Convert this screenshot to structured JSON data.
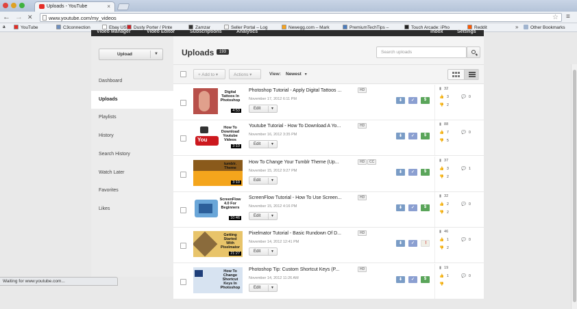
{
  "browser": {
    "tab_title": "Uploads - YouTube",
    "tab_close": "×",
    "url": "www.youtube.com/my_videos",
    "back": "←",
    "forward": "→",
    "reload": "✕",
    "star": "☆",
    "wrench": "≡",
    "bookmarks": [
      {
        "label": "YouTube",
        "color": "#e52d27"
      },
      {
        "label": "C3connection",
        "color": "#6e8fbf"
      },
      {
        "label": "Ebay US",
        "color": "#ffffff"
      },
      {
        "label": "Dusty Porter / Pinte",
        "color": "#cb2027"
      },
      {
        "label": "Zamzar",
        "color": "#333333"
      },
      {
        "label": "Seller Portal – Log",
        "color": "#f3f3f3"
      },
      {
        "label": "Newegg.com – Mark",
        "color": "#f7a21b"
      },
      {
        "label": "PremiumTechTips –",
        "color": "#4a7bbd"
      },
      {
        "label": "Touch Arcade: iPho",
        "color": "#222222"
      },
      {
        "label": "Reddit",
        "color": "#ff5700"
      }
    ],
    "bookmarks_more": "»",
    "other_bookmarks": "Other Bookmarks",
    "status_text": "Waiting for www.youtube.com..."
  },
  "topnav": [
    "Video Manager",
    "Video Editor",
    "Subscriptions",
    "Analytics",
    "Inbox",
    "Settings"
  ],
  "sidebar": {
    "upload_label": "Upload",
    "items": [
      {
        "label": "Dashboard",
        "active": false
      },
      {
        "label": "Uploads",
        "active": true
      },
      {
        "label": "Playlists",
        "active": false
      },
      {
        "label": "History",
        "active": false
      },
      {
        "label": "Search History",
        "active": false
      },
      {
        "label": "Watch Later",
        "active": false
      },
      {
        "label": "Favorites",
        "active": false
      },
      {
        "label": "Likes",
        "active": false
      }
    ]
  },
  "main": {
    "title": "Uploads",
    "count": "193",
    "search_placeholder": "Search uploads",
    "add_to": "+ Add to ▾",
    "actions": "Actions ▾",
    "view_label": "View:",
    "sort": "Newest",
    "edit_label": "Edit",
    "videos": [
      {
        "title": "Photoshop Tutorial - Apply Digital Tattoos ...",
        "date": "November 17, 2012 6:11 PM",
        "duration": "4:53",
        "badges": [
          "HD"
        ],
        "thumb_text": "Digital Tattoos In Photoshop",
        "views": "32",
        "likes": "3",
        "comments": "2",
        "dislikes": "0",
        "icon3": "$",
        "icon3_type": "dol",
        "thumb": "tattoo"
      },
      {
        "title": "Youtube Tutorial - How To Download A Yo...",
        "date": "November 16, 2012 3:35 PM",
        "duration": "3:10",
        "badges": [
          "HD"
        ],
        "thumb_text": "How To Download Youtube Videos",
        "views": "88",
        "likes": "7",
        "comments": "5",
        "dislikes": "0",
        "icon3": "$",
        "icon3_type": "dol",
        "thumb": "youtube"
      },
      {
        "title": "How To Change Your Tumblr Theme (Up...",
        "date": "November 15, 2012 9:27 PM",
        "duration": "3:10",
        "badges": [
          "HD",
          "CC"
        ],
        "thumb_text": "tumblr. Theme",
        "views": "37",
        "likes": "3",
        "comments": "2",
        "dislikes": "1",
        "icon3": "$",
        "icon3_type": "dol",
        "thumb": "tumblr"
      },
      {
        "title": "ScreenFlow Tutorial - How To Use Screen...",
        "date": "November 15, 2012 4:16 PM",
        "duration": "10:46",
        "badges": [
          "HD"
        ],
        "thumb_text": "ScreenFlow 4.0 For Beginners",
        "views": "32",
        "likes": "2",
        "comments": "2",
        "dislikes": "0",
        "icon3": "$",
        "icon3_type": "dol",
        "thumb": "screenflow"
      },
      {
        "title": "Pixelmator Tutorial - Basic Rundown Of D...",
        "date": "November 14, 2012 12:41 PM",
        "duration": "21:27",
        "badges": [
          "HD"
        ],
        "thumb_text": "Getting Started With Pixelmator",
        "views": "46",
        "likes": "1",
        "comments": "2",
        "dislikes": "0",
        "icon3": "!",
        "icon3_type": "ex",
        "thumb": "pixelmator"
      },
      {
        "title": "Photoshop Tip: Custom Shortcut Keys (P...",
        "date": "November 14, 2012 11:26 AM",
        "duration": "",
        "badges": [
          "HD"
        ],
        "thumb_text": "How To Change Shortcut Keys In Photoshop",
        "views": "19",
        "likes": "1",
        "comments": "",
        "dislikes": "0",
        "icon3": "$",
        "icon3_type": "dol",
        "thumb": "shortcut"
      }
    ]
  }
}
